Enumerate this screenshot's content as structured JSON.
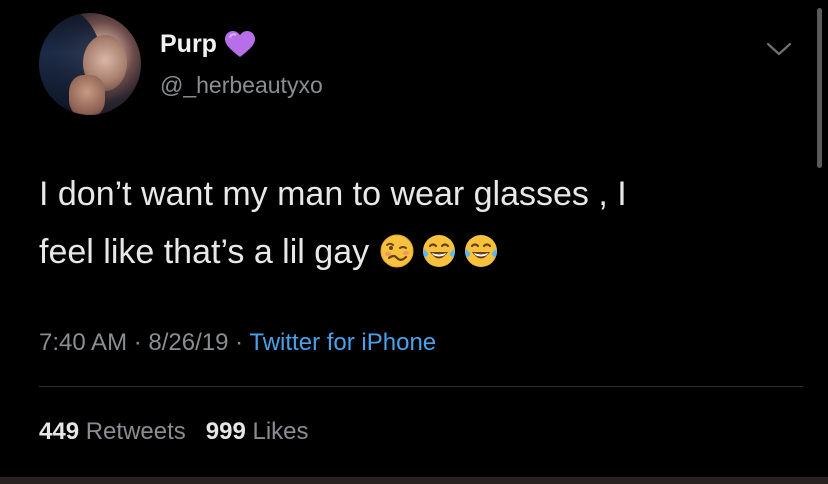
{
  "tweet": {
    "display_name": "Purp",
    "name_emoji": "purple-heart-icon",
    "handle": "@_herbeautyxo",
    "text_line1": "I don’t want my man to wear glasses , I",
    "text_line2": "feel like that’s a lil gay",
    "emojis": [
      "woozy-face-icon",
      "tears-of-joy-icon",
      "tears-of-joy-icon"
    ],
    "time": "7:40 AM",
    "date": "8/26/19",
    "separator": "·",
    "source": "Twitter for iPhone",
    "retweets_count": "449",
    "retweets_label": "Retweets",
    "likes_count": "999",
    "likes_label": "Likes"
  },
  "colors": {
    "background": "#000000",
    "primary_text": "#e8e8e8",
    "secondary_text": "#8a8d91",
    "link": "#4aa1eb",
    "heart": "#b66fe8"
  }
}
